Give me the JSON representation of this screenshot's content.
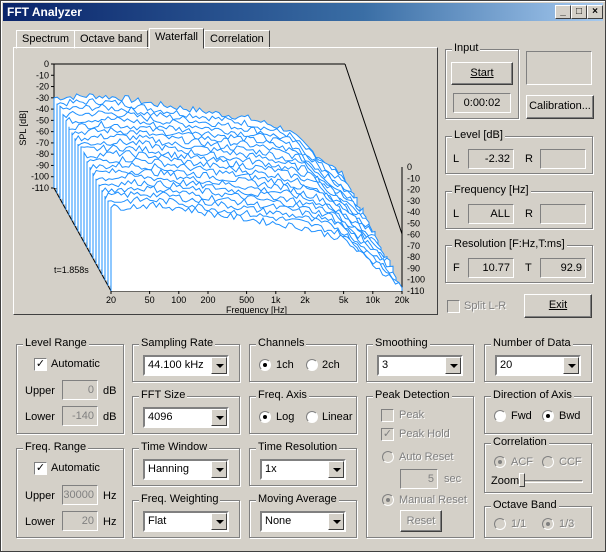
{
  "window": {
    "title": "FFT Analyzer"
  },
  "tabs": [
    "Spectrum",
    "Octave band",
    "Waterfall",
    "Correlation"
  ],
  "input": {
    "title": "Input",
    "start": "Start",
    "time": "0:00:02",
    "calibration": "Calibration..."
  },
  "level": {
    "title": "Level [dB]",
    "l_label": "L",
    "l_value": "-2.32",
    "r_label": "R",
    "r_value": ""
  },
  "frequency": {
    "title": "Frequency [Hz]",
    "l_label": "L",
    "l_value": "ALL",
    "r_label": "R",
    "r_value": ""
  },
  "resolution": {
    "title": "Resolution [F:Hz,T:ms]",
    "f_label": "F",
    "f_value": "10.77",
    "t_label": "T",
    "t_value": "92.9"
  },
  "split": "Split L-R",
  "exit": "Exit",
  "level_range": {
    "title": "Level Range",
    "auto": "Automatic",
    "upper": "Upper",
    "upper_val": "0",
    "lower": "Lower",
    "lower_val": "-140",
    "unit": "dB"
  },
  "freq_range": {
    "title": "Freq. Range",
    "auto": "Automatic",
    "upper": "Upper",
    "upper_val": "30000",
    "lower": "Lower",
    "lower_val": "20",
    "unit": "Hz"
  },
  "sampling_rate": {
    "title": "Sampling Rate",
    "value": "44.100 kHz"
  },
  "fft_size": {
    "title": "FFT Size",
    "value": "4096"
  },
  "time_window": {
    "title": "Time Window",
    "value": "Hanning"
  },
  "freq_weighting": {
    "title": "Freq. Weighting",
    "value": "Flat"
  },
  "channels": {
    "title": "Channels",
    "opt1": "1ch",
    "opt2": "2ch"
  },
  "freq_axis": {
    "title": "Freq. Axis",
    "opt1": "Log",
    "opt2": "Linear"
  },
  "time_resolution": {
    "title": "Time Resolution",
    "value": "1x"
  },
  "moving_average": {
    "title": "Moving Average",
    "value": "None"
  },
  "smoothing": {
    "title": "Smoothing",
    "value": "3"
  },
  "peak_detection": {
    "title": "Peak Detection",
    "peak": "Peak",
    "peak_hold": "Peak Hold",
    "auto_reset": "Auto Reset",
    "sec_val": "5",
    "sec": "sec",
    "manual_reset": "Manual Reset",
    "reset": "Reset"
  },
  "number_of_data": {
    "title": "Number of Data",
    "value": "20"
  },
  "direction": {
    "title": "Direction of Axis",
    "opt1": "Fwd",
    "opt2": "Bwd"
  },
  "correlation": {
    "title": "Correlation",
    "opt1": "ACF",
    "opt2": "CCF",
    "zoom": "Zoom"
  },
  "octave_band": {
    "title": "Octave Band",
    "opt1": "1/1",
    "opt2": "1/3"
  },
  "chart_data": {
    "type": "waterfall",
    "ylabel": "SPL [dB]",
    "xlabel": "Frequency [Hz]",
    "time_label": "t=1.858s",
    "y_ticks": [
      "0",
      "-10",
      "-20",
      "-30",
      "-40",
      "-50",
      "-60",
      "-70",
      "-80",
      "-90",
      "-100",
      "-110"
    ],
    "y_ticks_right": [
      "0",
      "-10",
      "-20",
      "-30",
      "-40",
      "-50",
      "-60",
      "-70",
      "-80",
      "-90",
      "-100",
      "-110"
    ],
    "x_ticks": [
      "20",
      "50",
      "100",
      "200",
      "500",
      "1k",
      "2k",
      "5k",
      "10k",
      "20k"
    ],
    "x_tick_values": [
      20,
      50,
      100,
      200,
      500,
      1000,
      2000,
      5000,
      10000,
      20000
    ],
    "ylim": [
      -110,
      0
    ],
    "xlim": [
      20,
      20000
    ],
    "slices": 20,
    "time_range_s": [
      0,
      1.858
    ],
    "line_color": "#1e90ff",
    "approx_profile_db": [
      -30,
      -28,
      -30,
      -35,
      -40,
      -44,
      -48,
      -58,
      -80,
      -100
    ]
  }
}
